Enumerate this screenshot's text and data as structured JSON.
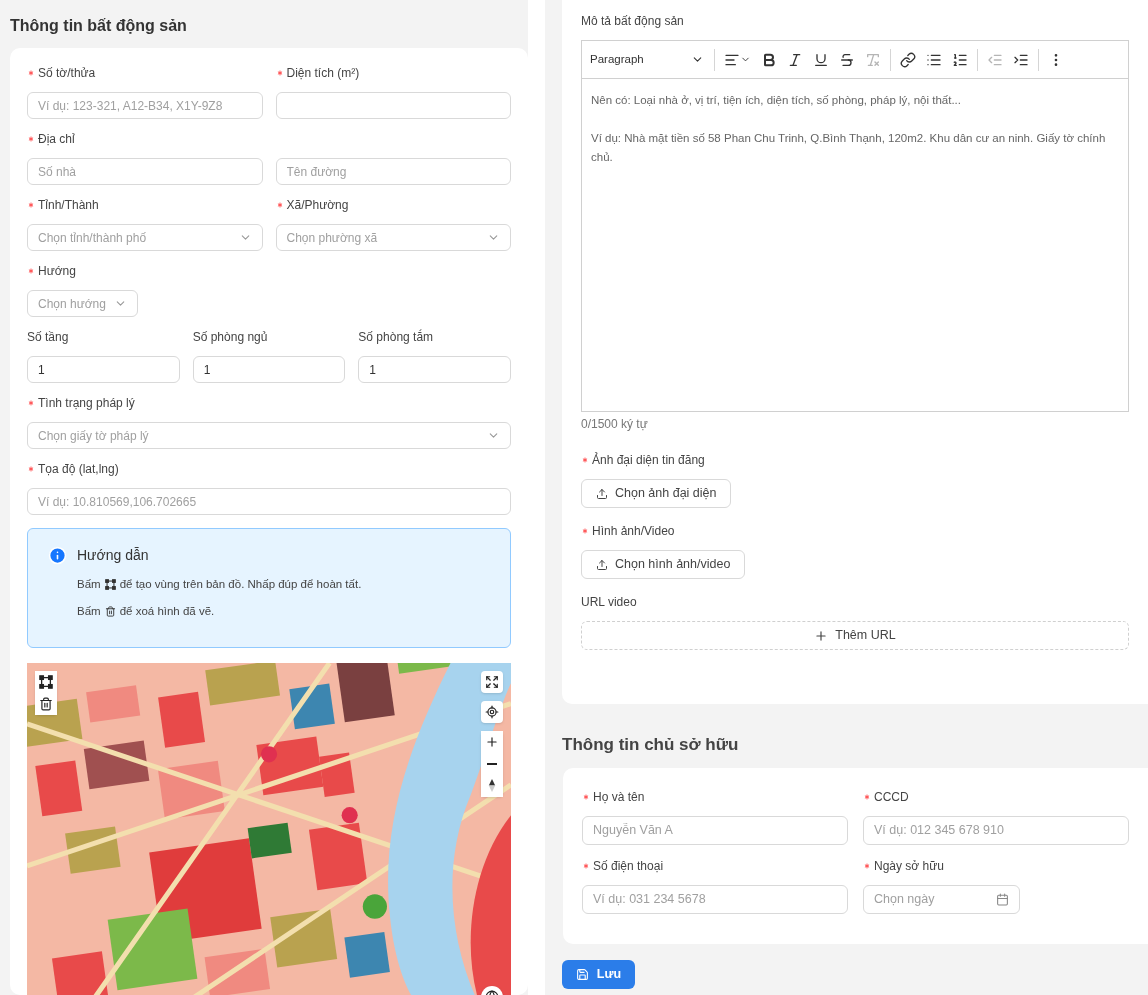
{
  "property_section": {
    "title": "Thông tin bất động sản",
    "rows": [
      {
        "fields": [
          {
            "label": "Số tờ/thửa",
            "required": true,
            "controls": [
              {
                "kind": "input",
                "placeholder": "Ví dụ: 123-321, A12-B34, X1Y-9Z8"
              }
            ]
          },
          {
            "label": "Diện tích (m²)",
            "required": true,
            "controls": [
              {
                "kind": "input"
              }
            ]
          }
        ]
      },
      {
        "fields": [
          {
            "label": "Địa chỉ",
            "required": true,
            "controls": [
              {
                "kind": "input",
                "placeholder": "Số nhà"
              },
              {
                "kind": "input",
                "placeholder": "Tên đường"
              }
            ]
          }
        ]
      },
      {
        "fields": [
          {
            "label": "Tỉnh/Thành",
            "required": true,
            "controls": [
              {
                "kind": "select",
                "placeholder": "Chọn tỉnh/thành phố"
              }
            ]
          },
          {
            "label": "Xã/Phường",
            "required": true,
            "controls": [
              {
                "kind": "select",
                "placeholder": "Chọn phường xã"
              }
            ]
          }
        ]
      },
      {
        "fields": [
          {
            "label": "Hướng",
            "required": true,
            "controls": [
              {
                "kind": "inline-select",
                "placeholder": "Chọn hướng"
              }
            ]
          }
        ]
      },
      {
        "fields": [
          {
            "label": "Số tầng",
            "required": false,
            "controls": [
              {
                "kind": "input",
                "value": "1"
              }
            ]
          },
          {
            "label": "Số phòng ngủ",
            "required": false,
            "controls": [
              {
                "kind": "input",
                "value": "1"
              }
            ]
          },
          {
            "label": "Số phòng tắm",
            "required": false,
            "controls": [
              {
                "kind": "input",
                "value": "1"
              }
            ]
          }
        ]
      },
      {
        "fields": [
          {
            "label": "Tình trạng pháp lý",
            "required": true,
            "controls": [
              {
                "kind": "select",
                "placeholder": "Chọn giấy tờ pháp lý"
              }
            ]
          }
        ]
      },
      {
        "fields": [
          {
            "label": "Tọa độ (lat,lng)",
            "required": true,
            "controls": [
              {
                "kind": "input",
                "placeholder": "Ví dụ: 10.810569,106.702665"
              }
            ]
          }
        ]
      }
    ],
    "guide": {
      "title": "Hướng dẫn",
      "lines": [
        {
          "before": "Bấm",
          "after": "để tạo vùng trên bản đồ. Nhấp đúp để hoàn tất."
        },
        {
          "before": "Bấm",
          "after": "để xoá hình đã vẽ."
        }
      ]
    }
  },
  "description": {
    "label": "Mô tả bất động sản",
    "block_style": "Paragraph",
    "tools": [
      {
        "kind": "separator"
      },
      {
        "kind": "align",
        "disabled": false
      },
      {
        "kind": "bold",
        "disabled": false
      },
      {
        "kind": "italic",
        "disabled": false
      },
      {
        "kind": "underline",
        "disabled": false
      },
      {
        "kind": "strike",
        "disabled": false
      },
      {
        "kind": "clear",
        "disabled": true
      },
      {
        "kind": "separator"
      },
      {
        "kind": "link",
        "disabled": false
      },
      {
        "kind": "bullets",
        "disabled": false
      },
      {
        "kind": "numbers",
        "disabled": false
      },
      {
        "kind": "separator"
      },
      {
        "kind": "outdent",
        "disabled": true
      },
      {
        "kind": "indent",
        "disabled": false
      },
      {
        "kind": "separator"
      },
      {
        "kind": "more",
        "disabled": false
      }
    ],
    "placeholder_lines": [
      "Nên có: Loại nhà ở, vị trí, tiện ích, diện tích, số phòng, pháp lý, nội thất...",
      "Ví dụ: Nhà mặt tiền số 58 Phan Chu Trinh, Q.Bình Thạnh, 120m2. Khu dân cư an ninh. Giấy tờ chính chủ."
    ],
    "counter": "0/1500 ký tự"
  },
  "media": [
    {
      "label": "Ảnh đại diện tin đăng",
      "required": true,
      "kind": "upload",
      "button": "Chọn ảnh đại diện"
    },
    {
      "label": "Hình ảnh/Video",
      "required": true,
      "kind": "upload",
      "button": "Chọn hình ảnh/video"
    },
    {
      "label": "URL video",
      "required": false,
      "kind": "add",
      "button": "Thêm URL"
    }
  ],
  "owner_section": {
    "title": "Thông tin chủ sở hữu",
    "fields": [
      {
        "label": "Họ và tên",
        "required": true,
        "kind": "input",
        "placeholder": "Nguyễn Văn A"
      },
      {
        "label": "CCCD",
        "required": true,
        "kind": "input",
        "placeholder": "Ví dụ: 012 345 678 910"
      },
      {
        "label": "Số điện thoại",
        "required": true,
        "kind": "input",
        "placeholder": "Ví dụ: 031 234 5678"
      },
      {
        "label": "Ngày sở hữu",
        "required": true,
        "kind": "date",
        "placeholder": "Chọn ngày"
      }
    ]
  },
  "save_button": "Lưu"
}
